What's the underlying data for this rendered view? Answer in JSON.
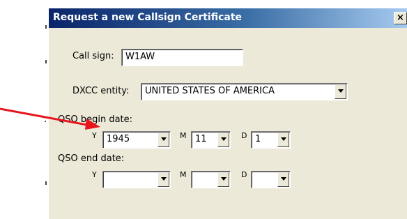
{
  "dialog": {
    "title": "Request a new Callsign Certificate",
    "close_label": "×"
  },
  "form": {
    "callsign_label": "Call sign:",
    "callsign_value": "W1AW",
    "dxcc_label": "DXCC entity:",
    "dxcc_value": "UNITED STATES OF AMERICA",
    "qso_begin_label": "QSO begin date:",
    "qso_end_label": "QSO end date:",
    "y_label": "Y",
    "m_label": "M",
    "d_label": "D",
    "begin": {
      "year": "1945",
      "month": "11",
      "day": "1"
    },
    "end": {
      "year": "",
      "month": "",
      "day": ""
    }
  },
  "background_marks": [
    ":",
    ":"
  ],
  "annotation": {
    "arrow_color": "#e8141b"
  }
}
